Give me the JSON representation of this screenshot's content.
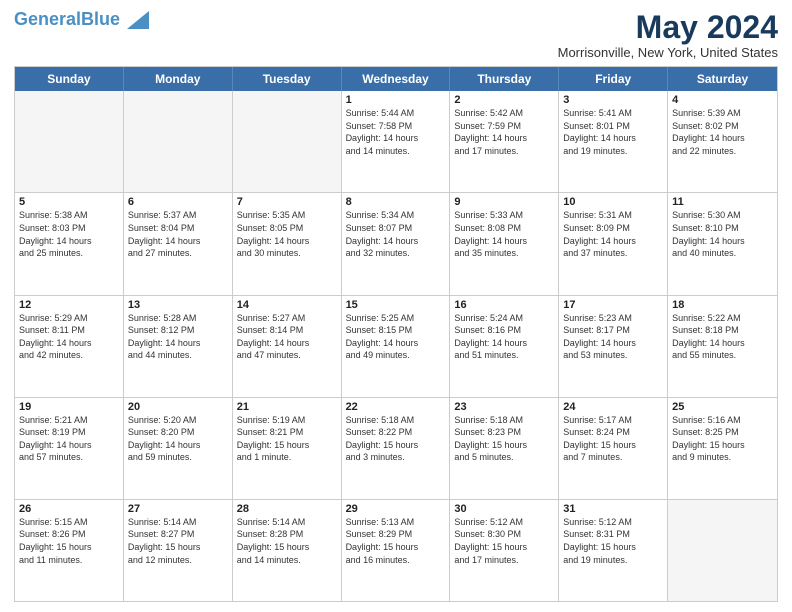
{
  "header": {
    "logo_general": "General",
    "logo_blue": "Blue",
    "title": "May 2024",
    "location": "Morrisonville, New York, United States"
  },
  "days_of_week": [
    "Sunday",
    "Monday",
    "Tuesday",
    "Wednesday",
    "Thursday",
    "Friday",
    "Saturday"
  ],
  "weeks": [
    [
      {
        "day": "",
        "info": "",
        "empty": true
      },
      {
        "day": "",
        "info": "",
        "empty": true
      },
      {
        "day": "",
        "info": "",
        "empty": true
      },
      {
        "day": "1",
        "info": "Sunrise: 5:44 AM\nSunset: 7:58 PM\nDaylight: 14 hours\nand 14 minutes.",
        "empty": false
      },
      {
        "day": "2",
        "info": "Sunrise: 5:42 AM\nSunset: 7:59 PM\nDaylight: 14 hours\nand 17 minutes.",
        "empty": false
      },
      {
        "day": "3",
        "info": "Sunrise: 5:41 AM\nSunset: 8:01 PM\nDaylight: 14 hours\nand 19 minutes.",
        "empty": false
      },
      {
        "day": "4",
        "info": "Sunrise: 5:39 AM\nSunset: 8:02 PM\nDaylight: 14 hours\nand 22 minutes.",
        "empty": false
      }
    ],
    [
      {
        "day": "5",
        "info": "Sunrise: 5:38 AM\nSunset: 8:03 PM\nDaylight: 14 hours\nand 25 minutes.",
        "empty": false
      },
      {
        "day": "6",
        "info": "Sunrise: 5:37 AM\nSunset: 8:04 PM\nDaylight: 14 hours\nand 27 minutes.",
        "empty": false
      },
      {
        "day": "7",
        "info": "Sunrise: 5:35 AM\nSunset: 8:05 PM\nDaylight: 14 hours\nand 30 minutes.",
        "empty": false
      },
      {
        "day": "8",
        "info": "Sunrise: 5:34 AM\nSunset: 8:07 PM\nDaylight: 14 hours\nand 32 minutes.",
        "empty": false
      },
      {
        "day": "9",
        "info": "Sunrise: 5:33 AM\nSunset: 8:08 PM\nDaylight: 14 hours\nand 35 minutes.",
        "empty": false
      },
      {
        "day": "10",
        "info": "Sunrise: 5:31 AM\nSunset: 8:09 PM\nDaylight: 14 hours\nand 37 minutes.",
        "empty": false
      },
      {
        "day": "11",
        "info": "Sunrise: 5:30 AM\nSunset: 8:10 PM\nDaylight: 14 hours\nand 40 minutes.",
        "empty": false
      }
    ],
    [
      {
        "day": "12",
        "info": "Sunrise: 5:29 AM\nSunset: 8:11 PM\nDaylight: 14 hours\nand 42 minutes.",
        "empty": false
      },
      {
        "day": "13",
        "info": "Sunrise: 5:28 AM\nSunset: 8:12 PM\nDaylight: 14 hours\nand 44 minutes.",
        "empty": false
      },
      {
        "day": "14",
        "info": "Sunrise: 5:27 AM\nSunset: 8:14 PM\nDaylight: 14 hours\nand 47 minutes.",
        "empty": false
      },
      {
        "day": "15",
        "info": "Sunrise: 5:25 AM\nSunset: 8:15 PM\nDaylight: 14 hours\nand 49 minutes.",
        "empty": false
      },
      {
        "day": "16",
        "info": "Sunrise: 5:24 AM\nSunset: 8:16 PM\nDaylight: 14 hours\nand 51 minutes.",
        "empty": false
      },
      {
        "day": "17",
        "info": "Sunrise: 5:23 AM\nSunset: 8:17 PM\nDaylight: 14 hours\nand 53 minutes.",
        "empty": false
      },
      {
        "day": "18",
        "info": "Sunrise: 5:22 AM\nSunset: 8:18 PM\nDaylight: 14 hours\nand 55 minutes.",
        "empty": false
      }
    ],
    [
      {
        "day": "19",
        "info": "Sunrise: 5:21 AM\nSunset: 8:19 PM\nDaylight: 14 hours\nand 57 minutes.",
        "empty": false
      },
      {
        "day": "20",
        "info": "Sunrise: 5:20 AM\nSunset: 8:20 PM\nDaylight: 14 hours\nand 59 minutes.",
        "empty": false
      },
      {
        "day": "21",
        "info": "Sunrise: 5:19 AM\nSunset: 8:21 PM\nDaylight: 15 hours\nand 1 minute.",
        "empty": false
      },
      {
        "day": "22",
        "info": "Sunrise: 5:18 AM\nSunset: 8:22 PM\nDaylight: 15 hours\nand 3 minutes.",
        "empty": false
      },
      {
        "day": "23",
        "info": "Sunrise: 5:18 AM\nSunset: 8:23 PM\nDaylight: 15 hours\nand 5 minutes.",
        "empty": false
      },
      {
        "day": "24",
        "info": "Sunrise: 5:17 AM\nSunset: 8:24 PM\nDaylight: 15 hours\nand 7 minutes.",
        "empty": false
      },
      {
        "day": "25",
        "info": "Sunrise: 5:16 AM\nSunset: 8:25 PM\nDaylight: 15 hours\nand 9 minutes.",
        "empty": false
      }
    ],
    [
      {
        "day": "26",
        "info": "Sunrise: 5:15 AM\nSunset: 8:26 PM\nDaylight: 15 hours\nand 11 minutes.",
        "empty": false
      },
      {
        "day": "27",
        "info": "Sunrise: 5:14 AM\nSunset: 8:27 PM\nDaylight: 15 hours\nand 12 minutes.",
        "empty": false
      },
      {
        "day": "28",
        "info": "Sunrise: 5:14 AM\nSunset: 8:28 PM\nDaylight: 15 hours\nand 14 minutes.",
        "empty": false
      },
      {
        "day": "29",
        "info": "Sunrise: 5:13 AM\nSunset: 8:29 PM\nDaylight: 15 hours\nand 16 minutes.",
        "empty": false
      },
      {
        "day": "30",
        "info": "Sunrise: 5:12 AM\nSunset: 8:30 PM\nDaylight: 15 hours\nand 17 minutes.",
        "empty": false
      },
      {
        "day": "31",
        "info": "Sunrise: 5:12 AM\nSunset: 8:31 PM\nDaylight: 15 hours\nand 19 minutes.",
        "empty": false
      },
      {
        "day": "",
        "info": "",
        "empty": true
      }
    ]
  ]
}
